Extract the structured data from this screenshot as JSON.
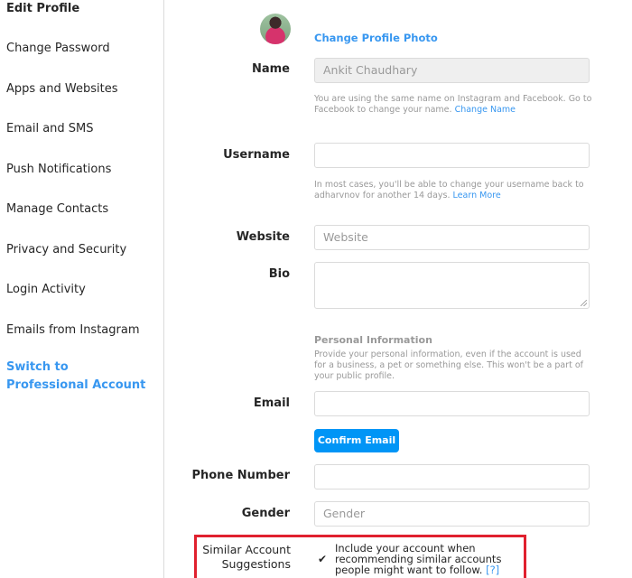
{
  "sidebar": {
    "items": [
      {
        "label": "Edit Profile",
        "active": true
      },
      {
        "label": "Change Password"
      },
      {
        "label": "Apps and Websites"
      },
      {
        "label": "Email and SMS"
      },
      {
        "label": "Push Notifications"
      },
      {
        "label": "Manage Contacts"
      },
      {
        "label": "Privacy and Security"
      },
      {
        "label": "Login Activity"
      },
      {
        "label": "Emails from Instagram"
      },
      {
        "label": "Switch to Professional Account",
        "accent": "#3897f0"
      }
    ]
  },
  "profile": {
    "change_photo_label": "Change Profile Photo",
    "avatar_icon": "profile-avatar"
  },
  "form": {
    "name": {
      "label": "Name",
      "value": "Ankit Chaudhary",
      "help": "You are using the same name on Instagram and Facebook. Go to Facebook to change your name.",
      "help_link": "Change Name"
    },
    "username": {
      "label": "Username",
      "value": "",
      "help": "In most cases, you'll be able to change your username back to adharvnov for another 14 days.",
      "help_link": "Learn More"
    },
    "website": {
      "label": "Website",
      "placeholder": "Website"
    },
    "bio": {
      "label": "Bio",
      "value": ""
    },
    "personal_info": {
      "title": "Personal Information",
      "description": "Provide your personal information, even if the account is used for a business, a pet or something else. This won't be a part of your public profile."
    },
    "email": {
      "label": "Email",
      "value": "",
      "confirm_button": "Confirm Email"
    },
    "phone": {
      "label": "Phone Number",
      "value": ""
    },
    "gender": {
      "label": "Gender",
      "placeholder": "Gender"
    },
    "similar_accounts": {
      "label": "Similar Account Suggestions",
      "checked": true,
      "text": "Include your account when recommending similar accounts people might want to follow.",
      "help_link": "[?]"
    }
  },
  "colors": {
    "accent": "#3897f0",
    "button": "#0095f6",
    "highlight": "#e0202e"
  }
}
